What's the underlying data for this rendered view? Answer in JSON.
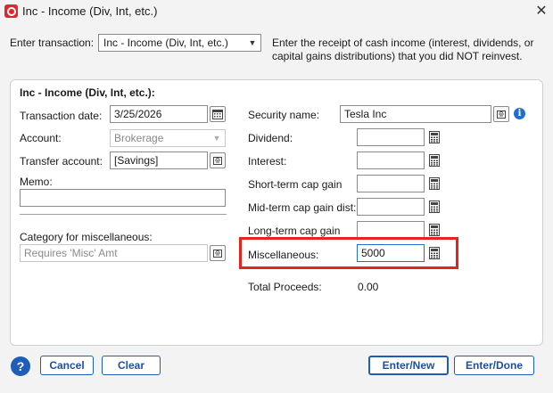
{
  "window": {
    "title": "Inc - Income (Div, Int, etc.)"
  },
  "top": {
    "enter_label": "Enter transaction:",
    "transaction_type": "Inc - Income (Div, Int, etc.)",
    "description": "Enter the receipt of cash income (interest, dividends, or capital gains distributions) that you did NOT reinvest."
  },
  "panel": {
    "heading": "Inc - Income (Div, Int, etc.):",
    "transaction_date_label": "Transaction date:",
    "transaction_date": "3/25/2026",
    "account_label": "Account:",
    "account": "Brokerage",
    "transfer_label": "Transfer account:",
    "transfer": "[Savings]",
    "memo_label": "Memo:",
    "memo": "",
    "category_label": "Category for miscellaneous:",
    "category": "Requires 'Misc' Amt",
    "security_label": "Security name:",
    "security": "Tesla Inc",
    "dividend_label": "Dividend:",
    "dividend": "",
    "interest_label": "Interest:",
    "interest": "",
    "short_label": "Short-term cap gain",
    "short": "",
    "mid_label": "Mid-term cap gain dist:",
    "mid": "",
    "long_label": "Long-term cap gain",
    "long": "",
    "misc_label": "Miscellaneous:",
    "misc": "5000",
    "total_label": "Total Proceeds:",
    "total": "0.00"
  },
  "buttons": {
    "help": "?",
    "cancel": "Cancel",
    "clear": "Clear",
    "enter_new": "Enter/New",
    "enter_done": "Enter/Done"
  },
  "colors": {
    "highlight": "#e3241f",
    "accent": "#1e5db8"
  }
}
